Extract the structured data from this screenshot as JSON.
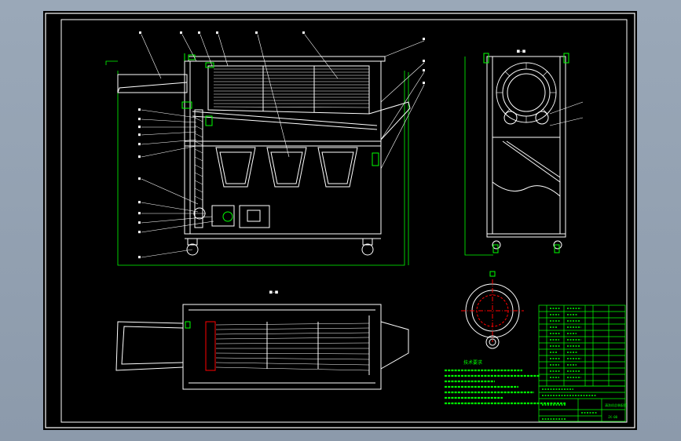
{
  "colors": {
    "background": "#8c9aab",
    "paper": "#000000",
    "frame": "#ffffff",
    "geometry": "#ffffff",
    "dimension": "#00ff00",
    "centerline": "#ff0000",
    "title_block": "#00ff00"
  },
  "sheet": {
    "views": [
      "main-view",
      "side-view",
      "plan-view",
      "section-detail"
    ],
    "tech_requirements_title": "技术要求",
    "title_block_caption": "清洗机总装配图",
    "drawing_id": "JX-00"
  }
}
